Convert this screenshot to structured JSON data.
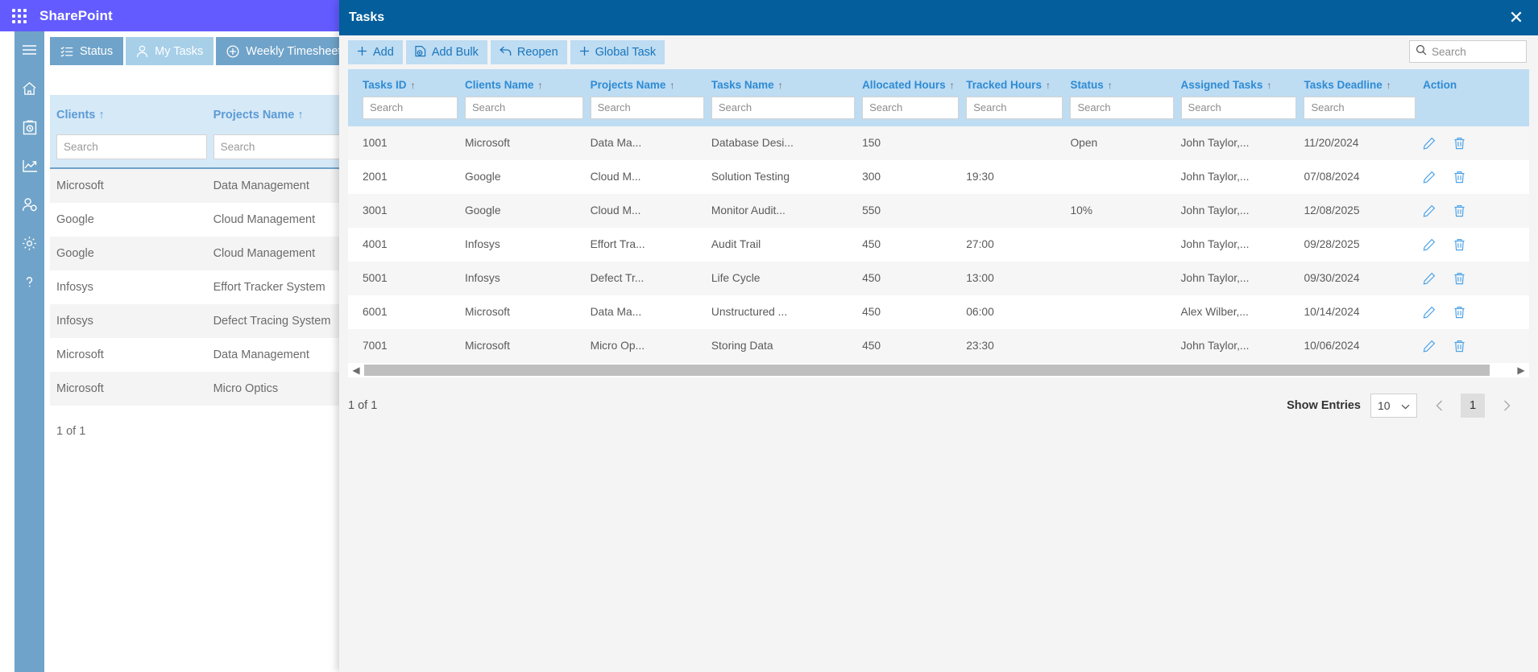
{
  "topbar": {
    "brand": "SharePoint",
    "waffle_icon": "app-grid-icon"
  },
  "rail": {
    "items": [
      {
        "icon": "hamburger-menu-icon",
        "name": "menu"
      },
      {
        "icon": "home-icon",
        "name": "home"
      },
      {
        "icon": "clipboard-clock-icon",
        "name": "timesheet"
      },
      {
        "icon": "chart-line-icon",
        "name": "reports"
      },
      {
        "icon": "user-settings-icon",
        "name": "user-admin"
      },
      {
        "icon": "gear-icon",
        "name": "settings"
      },
      {
        "icon": "question-mark-icon",
        "name": "help"
      }
    ]
  },
  "tabs": [
    {
      "label": "Status",
      "icon": "list-check-icon",
      "active": false
    },
    {
      "label": "My Tasks",
      "icon": "person-icon",
      "active": true
    },
    {
      "label": "Weekly Timesheet",
      "icon": "plus-circle-icon",
      "active": false
    }
  ],
  "tab_caret_icon": "chevron-down-icon",
  "background_grid": {
    "columns": [
      {
        "label": "Clients",
        "sort_icon": "sort-asc-arrow"
      },
      {
        "label": "Projects Name",
        "sort_icon": "sort-asc-arrow"
      }
    ],
    "search_placeholder": "Search",
    "rows": [
      {
        "client": "Microsoft",
        "project": "Data Management"
      },
      {
        "client": "Google",
        "project": "Cloud Management"
      },
      {
        "client": "Google",
        "project": "Cloud Management"
      },
      {
        "client": "Infosys",
        "project": "Effort Tracker System"
      },
      {
        "client": "Infosys",
        "project": "Defect Tracing System"
      },
      {
        "client": "Microsoft",
        "project": "Data Management"
      },
      {
        "client": "Microsoft",
        "project": "Micro Optics"
      }
    ],
    "footer": "1 of 1"
  },
  "modal": {
    "title": "Tasks",
    "close_icon": "close-icon",
    "toolbar": [
      {
        "label": "Add",
        "icon": "plus-icon"
      },
      {
        "label": "Add Bulk",
        "icon": "file-add-icon"
      },
      {
        "label": "Reopen",
        "icon": "undo-arrow-icon"
      },
      {
        "label": "Global Task",
        "icon": "plus-icon"
      }
    ],
    "top_search": {
      "placeholder": "Search",
      "value": "",
      "icon": "search-icon"
    },
    "columns": [
      {
        "label": "Tasks ID",
        "sortable": true
      },
      {
        "label": "Clients Name",
        "sortable": true
      },
      {
        "label": "Projects Name",
        "sortable": true
      },
      {
        "label": "Tasks Name",
        "sortable": true
      },
      {
        "label": "Allocated Hours",
        "sortable": true
      },
      {
        "label": "Tracked Hours",
        "sortable": true
      },
      {
        "label": "Status",
        "sortable": true
      },
      {
        "label": "Assigned Tasks",
        "sortable": true
      },
      {
        "label": "Tasks Deadline",
        "sortable": true
      },
      {
        "label": "Action",
        "sortable": false
      }
    ],
    "column_search_placeholder": "Search",
    "rows": [
      {
        "task_id": "1001",
        "client": "Microsoft",
        "project": "Data Ma...",
        "task_name": "Database Desi...",
        "allocated": "150",
        "tracked": "",
        "status": "Open",
        "assigned": "John Taylor,...",
        "deadline": "11/20/2024"
      },
      {
        "task_id": "2001",
        "client": "Google",
        "project": "Cloud M...",
        "task_name": "Solution Testing",
        "allocated": "300",
        "tracked": "19:30",
        "status": "",
        "assigned": "John Taylor,...",
        "deadline": "07/08/2024"
      },
      {
        "task_id": "3001",
        "client": "Google",
        "project": "Cloud M...",
        "task_name": "Monitor Audit...",
        "allocated": "550",
        "tracked": "",
        "status": "10%",
        "assigned": "John Taylor,...",
        "deadline": "12/08/2025"
      },
      {
        "task_id": "4001",
        "client": "Infosys",
        "project": "Effort Tra...",
        "task_name": "Audit Trail",
        "allocated": "450",
        "tracked": "27:00",
        "status": "",
        "assigned": "John Taylor,...",
        "deadline": "09/28/2025"
      },
      {
        "task_id": "5001",
        "client": "Infosys",
        "project": "Defect Tr...",
        "task_name": "Life Cycle",
        "allocated": "450",
        "tracked": "13:00",
        "status": "",
        "assigned": "John Taylor,...",
        "deadline": "09/30/2024"
      },
      {
        "task_id": "6001",
        "client": "Microsoft",
        "project": "Data Ma...",
        "task_name": "Unstructured ...",
        "allocated": "450",
        "tracked": "06:00",
        "status": "",
        "assigned": "Alex Wilber,...",
        "deadline": "10/14/2024"
      },
      {
        "task_id": "7001",
        "client": "Microsoft",
        "project": "Micro Op...",
        "task_name": "Storing Data",
        "allocated": "450",
        "tracked": "23:30",
        "status": "",
        "assigned": "John Taylor,...",
        "deadline": "10/06/2024"
      }
    ],
    "row_actions": {
      "edit_icon": "pencil-edit-icon",
      "delete_icon": "trash-delete-icon"
    },
    "footer": {
      "count_text": "1 of 1",
      "show_entries_label": "Show Entries",
      "entries_value": "10",
      "prev_icon": "chevron-left-icon",
      "next_icon": "chevron-right-icon",
      "current_page": "1"
    },
    "sort_arrow_glyph": "↑"
  },
  "colors": {
    "brand_purple": "#635BFF",
    "rail_blue": "#6FA3C9",
    "tab_active": "#A7CFE8",
    "modal_header": "#045E9C",
    "header_row": "#BEDCF2",
    "header_text": "#2E8BD4",
    "toolbar_btn": "#BEDCF2",
    "toolbar_text": "#1975BC",
    "action_icon": "#4DA3E8"
  }
}
